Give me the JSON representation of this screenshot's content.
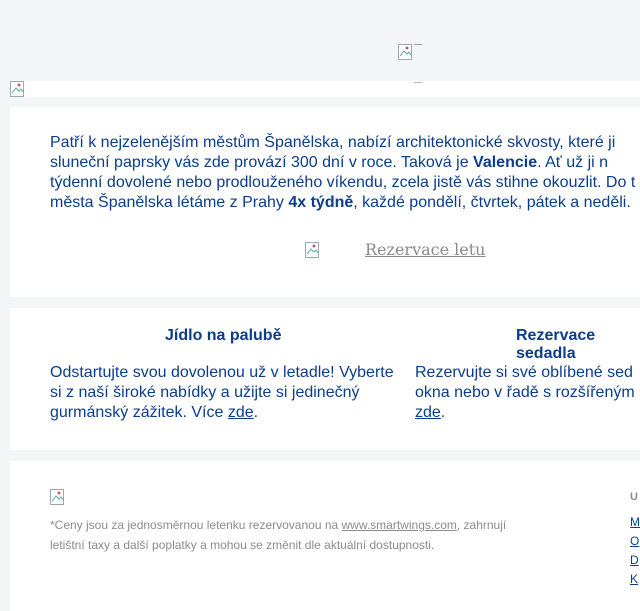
{
  "intro": {
    "line1": "Patří k nejzelenějším městům Španělska, nabízí architektonické skvosty, které ji",
    "line2_pre": "sluneční paprsky vás zde provází 300 dní v roce. Taková je ",
    "line2_bold": "Valencie",
    "line2_post": ". Ať už ji n",
    "line3": "týdenní dovolené nebo prodlouženého víkendu, zcela jistě vás stihne okouzlit. Do t",
    "line4_pre": "města Španělska létáme z Prahy ",
    "line4_bold": "4x týdně",
    "line4_post": ", každé pondělí, čtvrtek, pátek a neděli.",
    "button_label": "Rezervace letu"
  },
  "features": [
    {
      "title": "Jídlo na palubě",
      "line1": "Odstartujte svou dovolenou už v letadle! Vyberte",
      "line2": "si z naší široké nabídky a užijte si jedinečný",
      "line3_pre": "gurmánský zážitek. Více ",
      "link": "zde",
      "line3_post": "."
    },
    {
      "title": "Rezervace sedadla",
      "line1": "Rezervujte si své oblíbené sed",
      "line2": "okna nebo v řadě s rozšířeným",
      "link": "zde",
      "line3_post": "."
    }
  ],
  "footer": {
    "note_pre": "*Ceny jsou za jednosměrnou letenku rezervovanou na ",
    "note_link": "www.smartwings.com",
    "note_post": ", zahrnují letištní taxy a další poplatky a mohou se změnit dle aktuální dostupnosti.",
    "side_head": "U",
    "side_links": [
      "M",
      "O",
      "D",
      "K"
    ]
  },
  "colors": {
    "text": "#0b3d8c",
    "muted": "#8c8c8c",
    "bg": "#f4f5f7"
  },
  "icons": [
    "broken-image-icon"
  ]
}
